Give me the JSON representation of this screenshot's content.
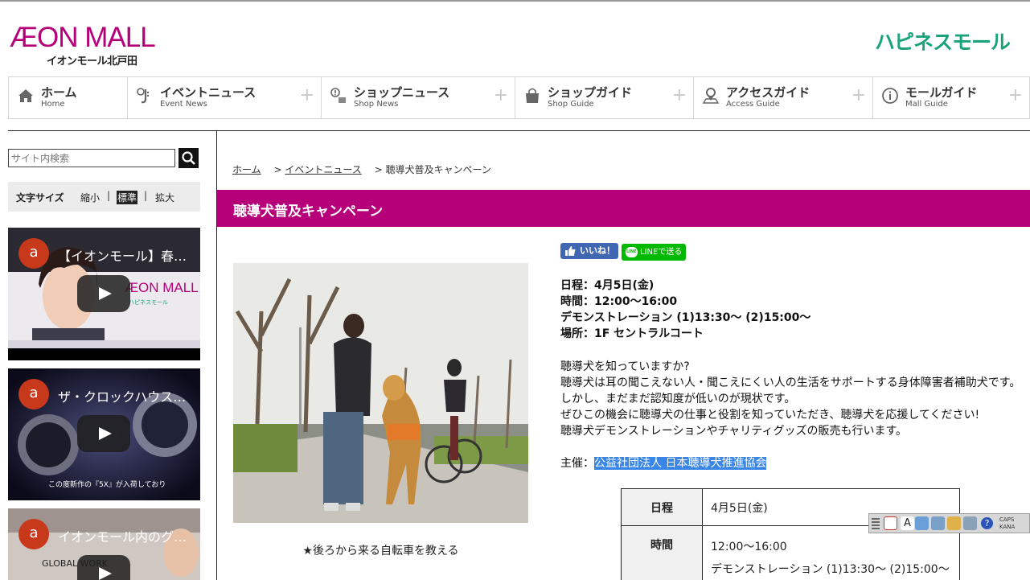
{
  "header": {
    "logo_main": "ÆON MALL",
    "logo_sub": "イオンモール北戸田",
    "tagline_logo": "ハピネスモール"
  },
  "nav": [
    {
      "ja": "ホーム",
      "en": "Home",
      "icon": "home-icon",
      "plus": ""
    },
    {
      "ja": "イベントニュース",
      "en": "Event News",
      "icon": "saxophone-icon",
      "plus": "+"
    },
    {
      "ja": "ショップニュース",
      "en": "Shop News",
      "icon": "speech-bubble-icon",
      "plus": "+"
    },
    {
      "ja": "ショップガイド",
      "en": "Shop Guide",
      "icon": "shopping-bag-icon",
      "plus": "+"
    },
    {
      "ja": "アクセスガイド",
      "en": "Access Guide",
      "icon": "map-pin-icon",
      "plus": "+"
    },
    {
      "ja": "モールガイド",
      "en": "Mall Guide",
      "icon": "info-icon",
      "plus": "+"
    }
  ],
  "sidebar": {
    "search_placeholder": "サイト内検索",
    "fontsize_label": "文字サイズ",
    "fontsize_small": "縮小",
    "fontsize_normal": "標準",
    "fontsize_large": "拡大",
    "sep": "|",
    "videos": [
      {
        "avatar": "a",
        "title": "【イオンモール】春ス…",
        "overlay_logo": "ÆON MALL",
        "overlay_sub": "ハピネスモール"
      },
      {
        "avatar": "a",
        "title": "ザ・クロックハウス…",
        "overlay_text": "この度新作の『5X』が入荷しており"
      },
      {
        "avatar": "a",
        "title": "イオンモール内のグ…",
        "overlay_text": "GLOBAL WORK"
      }
    ]
  },
  "breadcrumb": {
    "home": "ホーム",
    "sep": ">",
    "events": "イベントニュース",
    "current": "聴導犬普及キャンペーン"
  },
  "page_title": "聴導犬普及キャンペーン",
  "social": {
    "fb_label": "いいね！",
    "line_label": "LINEで送る"
  },
  "event_info": {
    "schedule": "日程：4月5日(金)",
    "time": "時間：12:00～16:00",
    "demo": "デモンストレーション (1)13:30～ (2)15:00～",
    "place": "場所：1F セントラルコート"
  },
  "description": [
    "聴導犬を知っていますか?",
    "聴導犬は耳の聞こえない人・聞こえにくい人の生活をサポートする身体障害者補助犬です。",
    "しかし、まだまだ認知度が低いのが現状です。",
    "ぜひこの機会に聴導犬の仕事と役割を知っていただき、聴導犬を応援してください!",
    "聴導犬デモンストレーションやチャリティグッズの販売も行います。"
  ],
  "organizer": {
    "label": "主催：",
    "name": "公益社団法人 日本聴導犬推進協会"
  },
  "photo_caption": "★後ろから来る自転車を教える",
  "table": {
    "rows": [
      {
        "header": "日程",
        "values": [
          "4月5日(金)"
        ]
      },
      {
        "header": "時間",
        "values": [
          "12:00～16:00",
          "デモンストレーション (1)13:30～ (2)15:00～"
        ]
      }
    ]
  },
  "langbar": {
    "caps": "CAPS",
    "kana": "KANA"
  }
}
